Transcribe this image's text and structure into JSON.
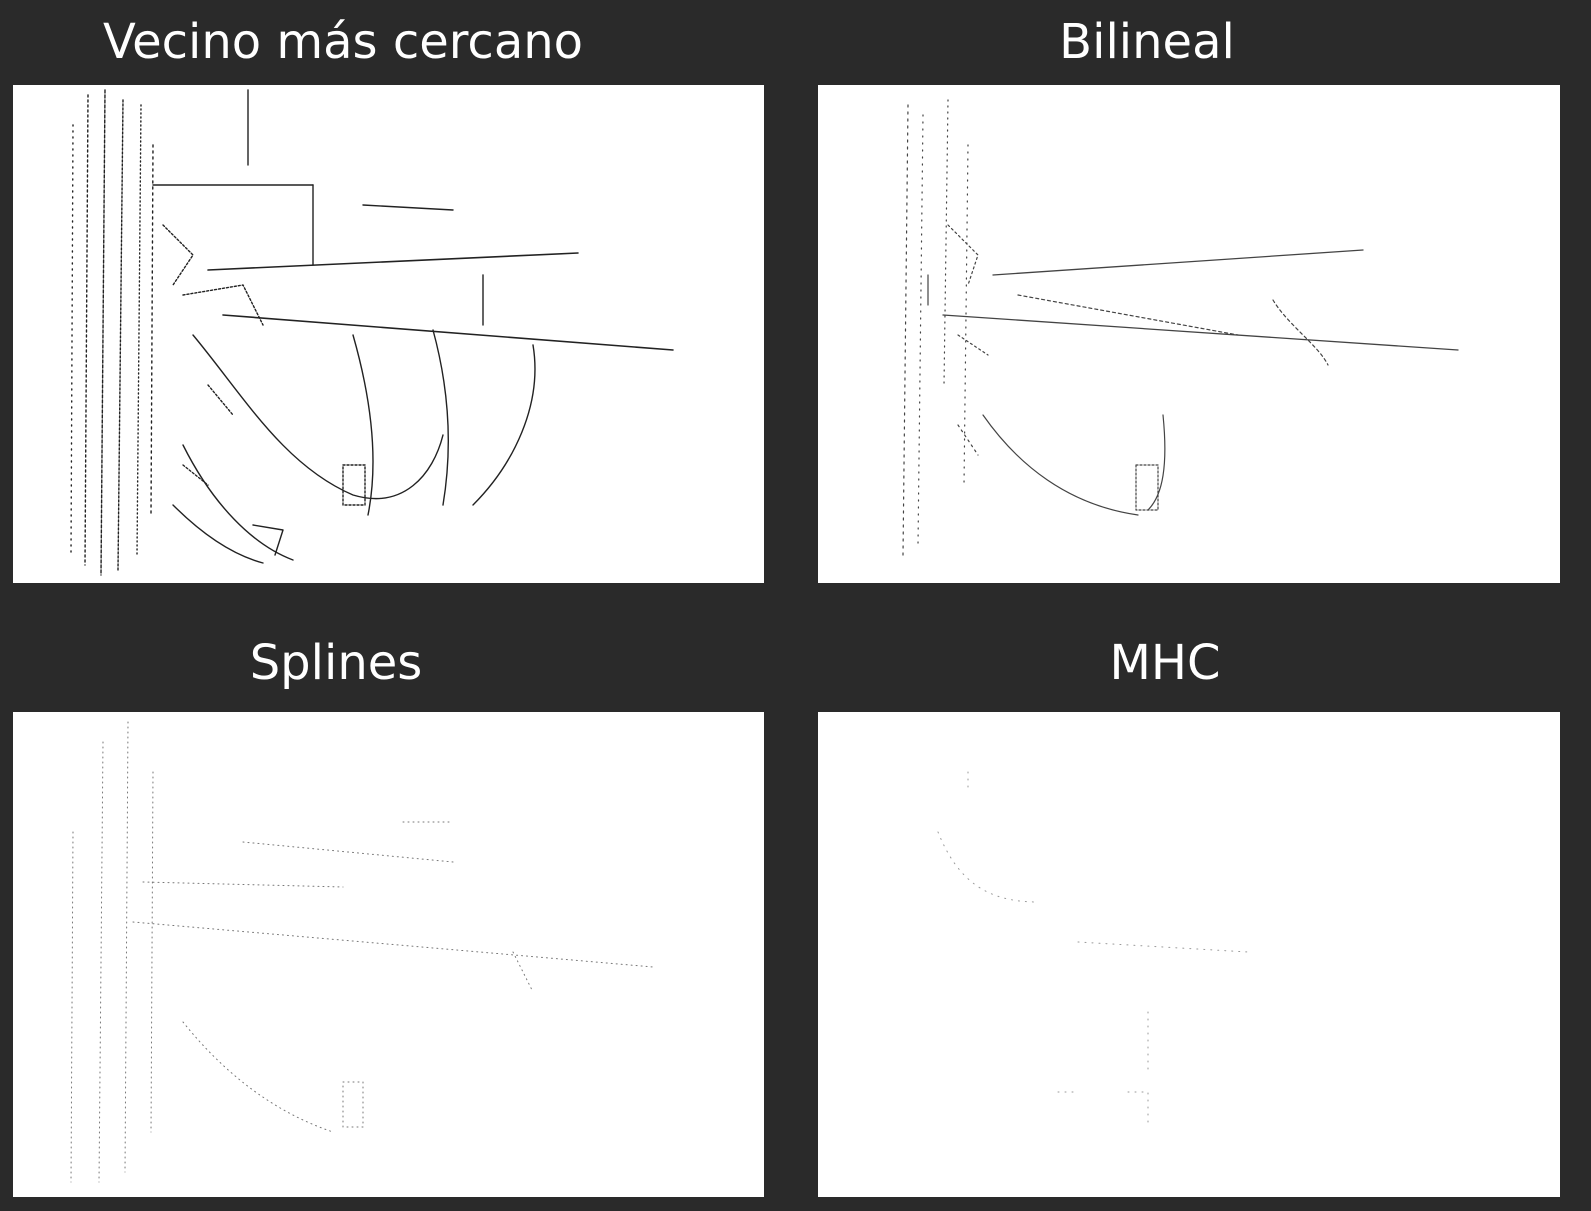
{
  "figure": {
    "background": "#2a2a2a",
    "panels": [
      {
        "title": "Vecino más cercano",
        "edge_color": "#1a1a1a",
        "edge_density": "high"
      },
      {
        "title": "Bilineal",
        "edge_color": "#3a3a3a",
        "edge_density": "medium"
      },
      {
        "title": "Splines",
        "edge_color": "#6a6a6a",
        "edge_density": "low"
      },
      {
        "title": "MHC",
        "edge_color": "#8a8a8a",
        "edge_density": "very-low"
      }
    ]
  }
}
